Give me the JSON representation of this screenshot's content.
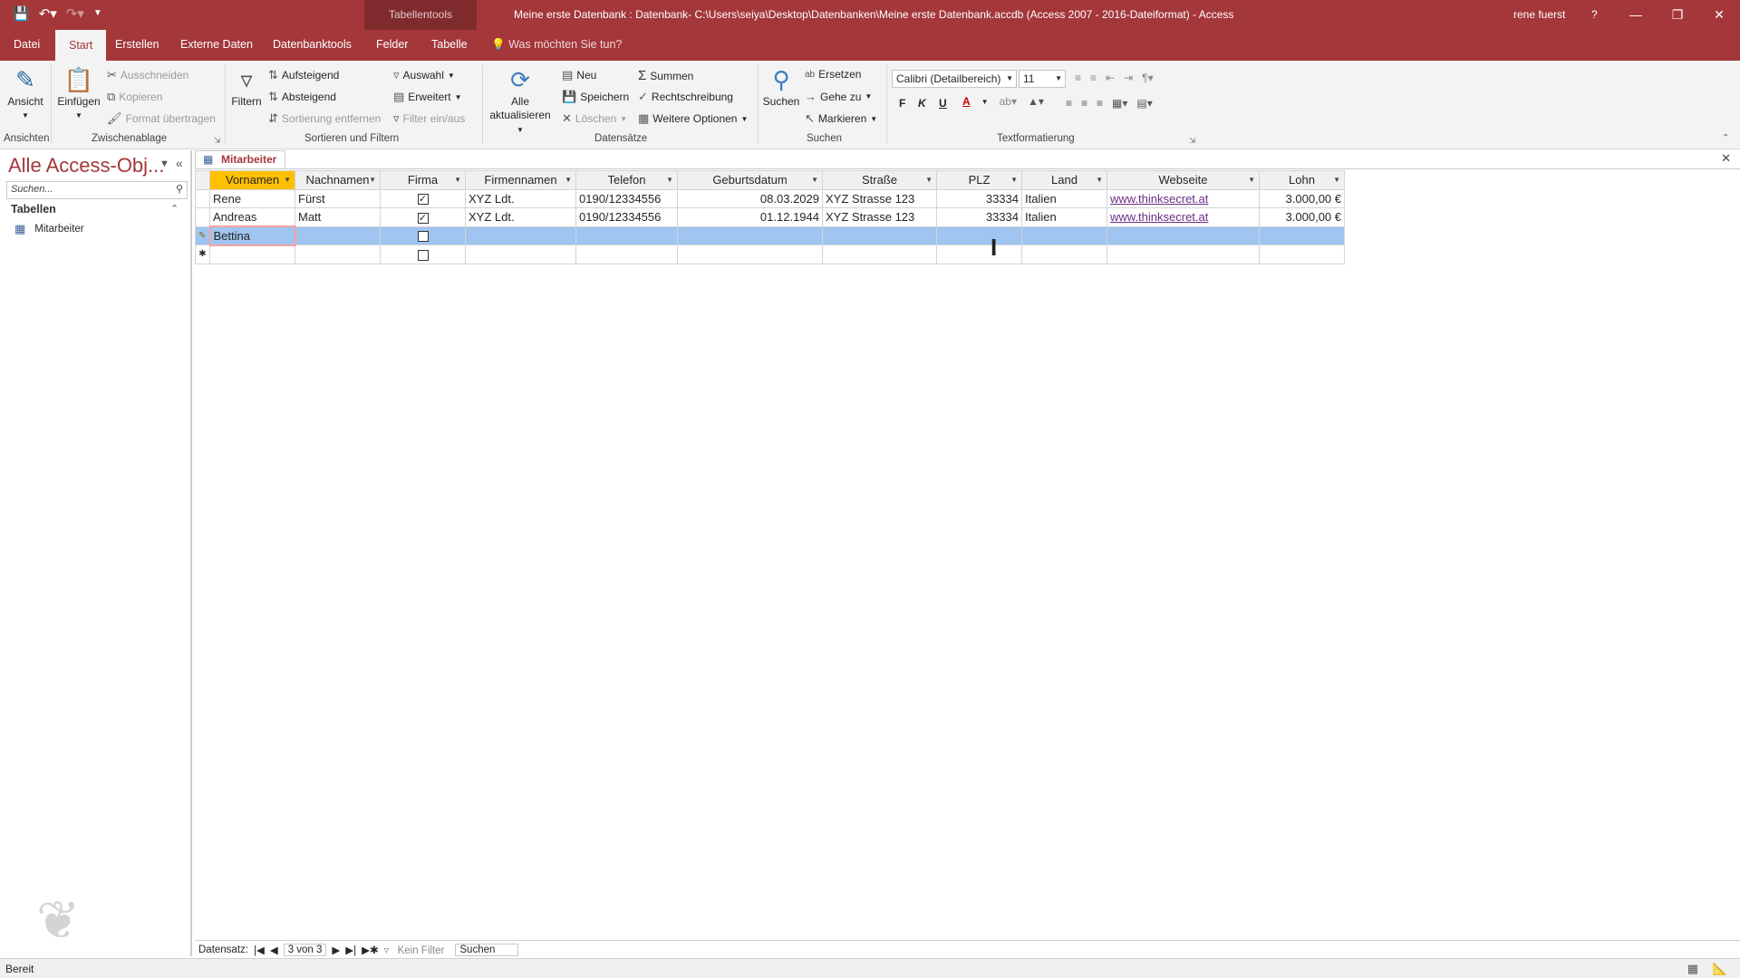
{
  "titlebar": {
    "context_tools": "Tabellentools",
    "title": "Meine erste Datenbank : Datenbank- C:\\Users\\seiya\\Desktop\\Datenbanken\\Meine erste Datenbank.accdb (Access 2007 - 2016-Dateiformat)  -  Access",
    "user": "rene fuerst",
    "help": "?",
    "qat_icons": [
      "save-icon",
      "undo-icon",
      "redo-icon",
      "customize-icon"
    ],
    "accent": "#a4373a"
  },
  "tabs": [
    "Datei",
    "Start",
    "Erstellen",
    "Externe Daten",
    "Datenbanktools",
    "Felder",
    "Tabelle"
  ],
  "tell_me": "Was möchten Sie tun?",
  "ribbon": {
    "ansichten": {
      "ansicht": "Ansicht",
      "label": "Ansichten"
    },
    "zwischenablage": {
      "einfuegen": "Einfügen",
      "ausschneiden": "Ausschneiden",
      "kopieren": "Kopieren",
      "format": "Format übertragen",
      "label": "Zwischenablage"
    },
    "sortieren": {
      "filtern": "Filtern",
      "aufsteigend": "Aufsteigend",
      "absteigend": "Absteigend",
      "sortierung_entfernen": "Sortierung entfernen",
      "auswahl": "Auswahl",
      "erweitert": "Erweitert",
      "filter_ein_aus": "Filter ein/aus",
      "label": "Sortieren und Filtern"
    },
    "datensaetze": {
      "alle": "Alle",
      "aktualisieren": "aktualisieren",
      "neu": "Neu",
      "speichern": "Speichern",
      "loeschen": "Löschen",
      "summen": "Summen",
      "rechtschreibung": "Rechtschreibung",
      "weitere": "Weitere Optionen",
      "label": "Datensätze"
    },
    "suchen": {
      "suchen": "Suchen",
      "ersetzen": "Ersetzen",
      "gehe_zu": "Gehe zu",
      "markieren": "Markieren",
      "label": "Suchen"
    },
    "text": {
      "font": "Calibri (Detailbereich)",
      "size": "11",
      "bold": "F",
      "italic": "K",
      "underline": "U",
      "label": "Textformatierung"
    }
  },
  "nav": {
    "title": "Alle Access-Obj...",
    "search_placeholder": "Suchen...",
    "section": "Tabellen",
    "items": [
      "Mitarbeiter"
    ]
  },
  "document": {
    "tab": "Mitarbeiter"
  },
  "grid": {
    "columns": [
      "Vornamen",
      "Nachnamen",
      "Firma",
      "Firmennamen",
      "Telefon",
      "Geburtsdatum",
      "Straße",
      "PLZ",
      "Land",
      "Webseite",
      "Lohn"
    ],
    "rows": [
      {
        "Vornamen": "Rene",
        "Nachnamen": "Fürst",
        "Firma": true,
        "Firmennamen": "XYZ Ldt.",
        "Telefon": "0190/12334556",
        "Geburtsdatum": "08.03.2029",
        "Straße": "XYZ Strasse 123",
        "PLZ": "33334",
        "Land": "Italien",
        "Webseite": "www.thinksecret.at",
        "Lohn": "3.000,00 €"
      },
      {
        "Vornamen": "Andreas",
        "Nachnamen": "Matt",
        "Firma": true,
        "Firmennamen": "XYZ Ldt.",
        "Telefon": "0190/12334556",
        "Geburtsdatum": "01.12.1944",
        "Straße": "XYZ Strasse 123",
        "PLZ": "33334",
        "Land": "Italien",
        "Webseite": "www.thinksecret.at",
        "Lohn": "3.000,00 €"
      },
      {
        "Vornamen": "Bettina",
        "Nachnamen": "",
        "Firma": false,
        "Firmennamen": "",
        "Telefon": "",
        "Geburtsdatum": "",
        "Straße": "",
        "PLZ": "",
        "Land": "",
        "Webseite": "",
        "Lohn": ""
      }
    ],
    "editing_row_color": "#9fc5f0",
    "selected_header_color": "#ffc000"
  },
  "record_nav": {
    "label": "Datensatz:",
    "position": "3 von 3",
    "filter": "Kein Filter",
    "search": "Suchen"
  },
  "status": {
    "text": "Bereit"
  }
}
